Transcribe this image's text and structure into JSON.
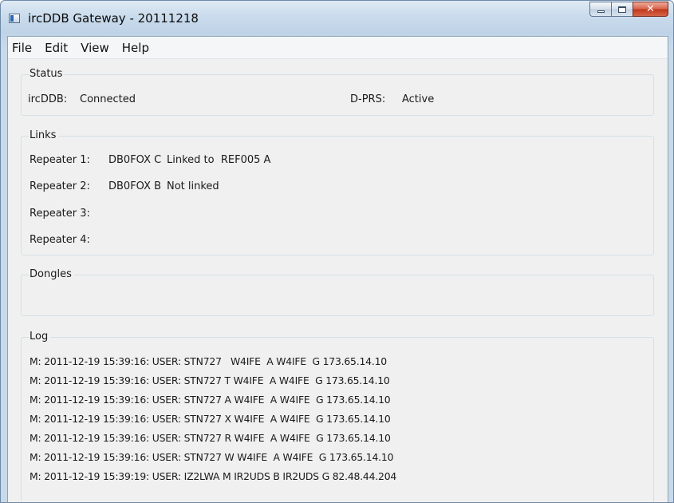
{
  "window": {
    "title": "ircDDB Gateway - 20111218"
  },
  "menu": {
    "items": [
      "File",
      "Edit",
      "View",
      "Help"
    ]
  },
  "status": {
    "label": "Status",
    "ircddb_label": "ircDDB:",
    "ircddb_value": "Connected",
    "dprs_label": "D-PRS:",
    "dprs_value": "Active"
  },
  "links": {
    "label": "Links",
    "repeaters": [
      {
        "label": "Repeater 1:",
        "callsign": "DB0FOX C",
        "status": "Linked to  REF005 A"
      },
      {
        "label": "Repeater 2:",
        "callsign": "DB0FOX B",
        "status": "Not linked"
      },
      {
        "label": "Repeater 3:",
        "callsign": "",
        "status": ""
      },
      {
        "label": "Repeater 4:",
        "callsign": "",
        "status": ""
      }
    ]
  },
  "dongles": {
    "label": "Dongles"
  },
  "log": {
    "label": "Log",
    "lines": [
      "M: 2011-12-19 15:39:16: USER: STN727   W4IFE  A W4IFE  G 173.65.14.10",
      "M: 2011-12-19 15:39:16: USER: STN727 T W4IFE  A W4IFE  G 173.65.14.10",
      "M: 2011-12-19 15:39:16: USER: STN727 A W4IFE  A W4IFE  G 173.65.14.10",
      "M: 2011-12-19 15:39:16: USER: STN727 X W4IFE  A W4IFE  G 173.65.14.10",
      "M: 2011-12-19 15:39:16: USER: STN727 R W4IFE  A W4IFE  G 173.65.14.10",
      "M: 2011-12-19 15:39:16: USER: STN727 W W4IFE  A W4IFE  G 173.65.14.10",
      "M: 2011-12-19 15:39:19: USER: IZ2LWA M IR2UDS B IR2UDS G 82.48.44.204"
    ]
  }
}
